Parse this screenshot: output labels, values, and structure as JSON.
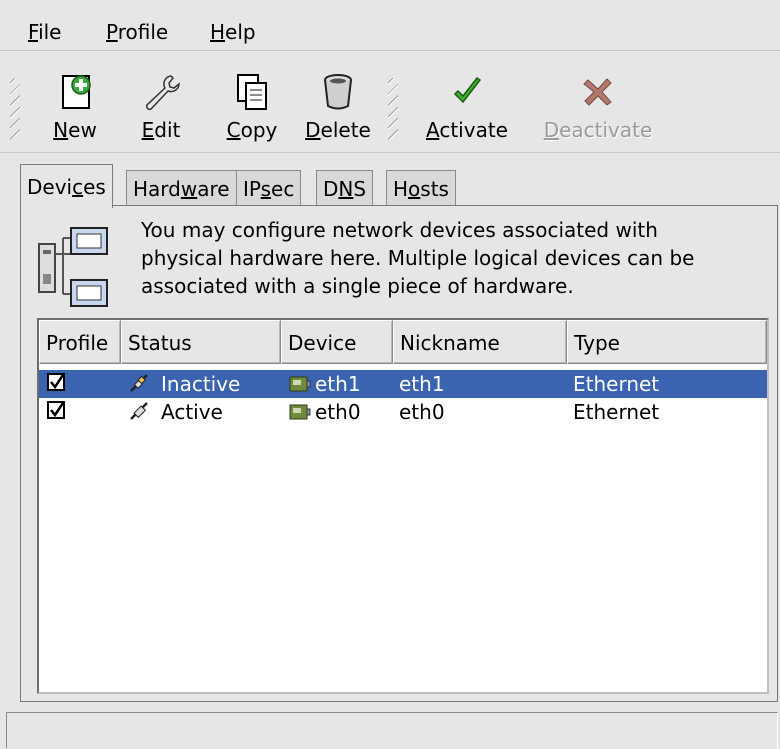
{
  "menubar": {
    "items": [
      {
        "hotkey": "F",
        "rest": "ile"
      },
      {
        "hotkey": "P",
        "rest": "rofile"
      },
      {
        "hotkey": "H",
        "rest": "elp"
      }
    ]
  },
  "toolbar": {
    "new": {
      "hotkey": "N",
      "rest": "ew",
      "icon": "new-icon"
    },
    "edit": {
      "hotkey": "E",
      "rest": "dit",
      "icon": "wrench-icon"
    },
    "copy": {
      "hotkey": "C",
      "rest": "opy",
      "icon": "copy-icon"
    },
    "delete": {
      "hotkey": "D",
      "rest": "elete",
      "icon": "trash-icon"
    },
    "activate": {
      "hotkey": "A",
      "rest": "ctivate",
      "icon": "checkmark-icon"
    },
    "deactivate": {
      "hotkey": "D",
      "rest": "eactivate",
      "icon": "x-icon",
      "disabled": true
    }
  },
  "tabs": [
    {
      "pre": "Devi",
      "hotkey": "c",
      "post": "es",
      "active": true
    },
    {
      "pre": "Hard",
      "hotkey": "w",
      "post": "are",
      "active": false
    },
    {
      "pre": "IP",
      "hotkey": "s",
      "post": "ec",
      "active": false
    },
    {
      "pre": "D",
      "hotkey": "N",
      "post": "S",
      "active": false
    },
    {
      "pre": "H",
      "hotkey": "o",
      "post": "sts",
      "active": false
    }
  ],
  "description": {
    "line1": "You may configure network devices associated with",
    "line2": "physical hardware here.  Multiple logical devices can be",
    "line3": "associated with a single piece of hardware."
  },
  "table": {
    "columns": [
      "Profile",
      "Status",
      "Device",
      "Nickname",
      "Type"
    ],
    "rows": [
      {
        "profile_checked": true,
        "status": "Inactive",
        "device": "eth1",
        "nickname": "eth1",
        "type": "Ethernet",
        "selected": true
      },
      {
        "profile_checked": true,
        "status": "Active",
        "device": "eth0",
        "nickname": "eth0",
        "type": "Ethernet",
        "selected": false
      }
    ]
  },
  "colors": {
    "selection": "#3a63b0",
    "window_bg": "#e6e6e6"
  }
}
